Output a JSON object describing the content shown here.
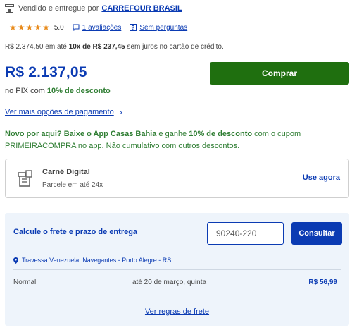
{
  "seller": {
    "prefix": "Vendido e entregue por",
    "name": "CARREFOUR BRASIL"
  },
  "rating": {
    "stars": 5,
    "score": "5.0",
    "reviews_link": "1 avaliações",
    "questions_link": "Sem perguntas"
  },
  "installments": {
    "full_price": "R$ 2.374,50",
    "middle": "em até",
    "plan": "10x de R$ 237,45",
    "suffix": "sem juros no cartão de crédito."
  },
  "price": {
    "value": "R$ 2.137,05",
    "pix_prefix": "no PIX com",
    "pix_discount": "10% de desconto"
  },
  "buy_button": "Comprar",
  "payment_options_link": "Ver mais opções de pagamento",
  "promo": {
    "part1": "Novo por aqui? Baixe o App Casas Bahia",
    "part2": " e ganhe ",
    "part3": "10% de desconto",
    "part4": " com o cupom PRIMEIRACOMPRA no app. Não cumulativo com outros descontos."
  },
  "carne": {
    "title": "Carnê Digital",
    "subtitle": "Parcele em até 24x",
    "action": "Use agora"
  },
  "freight": {
    "title": "Calcule o frete e prazo de entrega",
    "cep_value": "90240-220",
    "consult_button": "Consultar",
    "address": "Travessa Venezuela, Navegantes - Porto Alegre - RS",
    "option_name": "Normal",
    "option_date": "até 20 de março, quinta",
    "option_price": "R$ 56,99",
    "rules_link": "Ver regras de frete"
  },
  "colors": {
    "brand_blue": "#0b3bb3",
    "buy_green": "#1f6f0f",
    "promo_green": "#2e7d32",
    "star_orange": "#e88b1c"
  },
  "icons": [
    "store-icon",
    "star-icon",
    "chat-icon",
    "question-icon",
    "chevron-right-icon",
    "carne-icon",
    "location-pin-icon"
  ]
}
